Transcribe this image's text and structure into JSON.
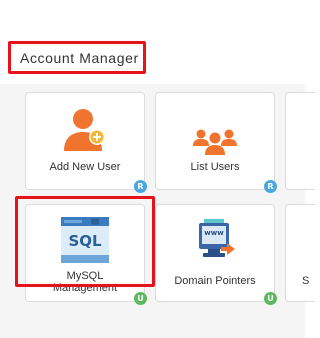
{
  "section": {
    "title": "Account Manager"
  },
  "cards": [
    {
      "label": "Add New User",
      "badge": "R",
      "badge_color": "#47a7de",
      "icon": "add-user-icon"
    },
    {
      "label": "List Users",
      "badge": "R",
      "badge_color": "#47a7de",
      "icon": "users-group-icon"
    },
    {
      "label_line1": "MySQL",
      "label_line2": "Management",
      "badge": "U",
      "badge_color": "#5cb85c",
      "icon": "sql-database-icon",
      "icon_text": "SQL"
    },
    {
      "label": "Domain Pointers",
      "badge": "U",
      "badge_color": "#5cb85c",
      "icon": "domain-www-icon",
      "icon_text": "www"
    }
  ],
  "partial_card_text": "S",
  "colors": {
    "highlight": "#e8121a",
    "accent_orange": "#f0742d",
    "badge_blue": "#47a7de",
    "badge_green": "#5cb85c"
  }
}
